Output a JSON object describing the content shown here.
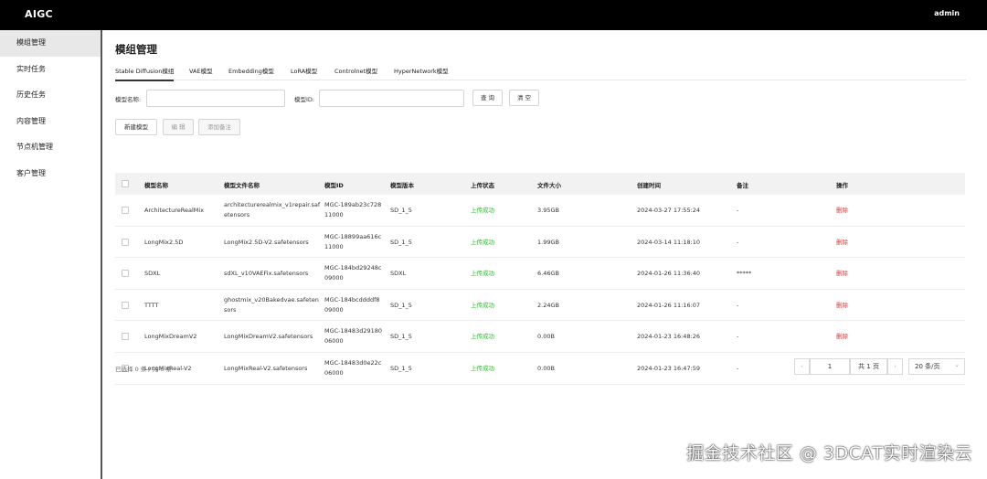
{
  "app": {
    "title": "AIGC",
    "user": "admin"
  },
  "sidebar": {
    "items": [
      {
        "label": "模组管理",
        "active": true
      },
      {
        "label": "实时任务",
        "active": false
      },
      {
        "label": "历史任务",
        "active": false
      },
      {
        "label": "内容管理",
        "active": false
      },
      {
        "label": "节点机管理",
        "active": false
      },
      {
        "label": "客户管理",
        "active": false
      }
    ]
  },
  "page": {
    "title": "模组管理"
  },
  "tabs": [
    {
      "label": "Stable Diffusion模组",
      "active": true
    },
    {
      "label": "VAE模型",
      "active": false
    },
    {
      "label": "Embedding模型",
      "active": false
    },
    {
      "label": "LoRA模型",
      "active": false
    },
    {
      "label": "Controlnet模型",
      "active": false
    },
    {
      "label": "HyperNetwork模型",
      "active": false
    }
  ],
  "search": {
    "name_label": "模型名称:",
    "name_value": "",
    "id_label": "模型ID:",
    "id_value": "",
    "query_button": "查 询",
    "clear_button": "清 空"
  },
  "actions": {
    "new_button": "新建模型",
    "edit_button": "编 辑",
    "note_button": "添加备注"
  },
  "table": {
    "headers": [
      "模型名称",
      "模型文件名称",
      "模型ID",
      "模型版本",
      "上传状态",
      "文件大小",
      "创建时间",
      "备注",
      "操作"
    ],
    "rows": [
      {
        "name": "ArchitectureRealMix",
        "file_l1": "architecturerealmix_v1repair.saf",
        "file_l2": "etensors",
        "id_l1": "MGC-189ab23c728",
        "id_l2": "11000",
        "version": "SD_1_5",
        "status": "上传成功",
        "size": "3.95GB",
        "created": "2024-03-27 17:55:24",
        "note": "-",
        "action": "删除"
      },
      {
        "name": "LongMix2.5D",
        "file_l1": "LongMix2.5D-V2.safetensors",
        "file_l2": "",
        "id_l1": "MGC-18899aa616c",
        "id_l2": "11000",
        "version": "SD_1_5",
        "status": "上传成功",
        "size": "1.99GB",
        "created": "2024-03-14 11:18:10",
        "note": "-",
        "action": "删除"
      },
      {
        "name": "SDXL",
        "file_l1": "sdXL_v10VAEFix.safetensors",
        "file_l2": "",
        "id_l1": "MGC-184bd29248c",
        "id_l2": "09000",
        "version": "SDXL",
        "status": "上传成功",
        "size": "6.46GB",
        "created": "2024-01-26 11:36:40",
        "note": "*****",
        "action": "删除"
      },
      {
        "name": "TTTT",
        "file_l1": "ghostmix_v20Bakedvae.safeten",
        "file_l2": "sors",
        "id_l1": "MGC-184bcddddf8",
        "id_l2": "09000",
        "version": "SD_1_5",
        "status": "上传成功",
        "size": "2.24GB",
        "created": "2024-01-26 11:16:07",
        "note": "-",
        "action": "删除"
      },
      {
        "name": "LongMixDreamV2",
        "file_l1": "LongMixDreamV2.safetensors",
        "file_l2": "",
        "id_l1": "MGC-18483d29180",
        "id_l2": "06000",
        "version": "SD_1_5",
        "status": "上传成功",
        "size": "0.00B",
        "created": "2024-01-23 16:48:26",
        "note": "-",
        "action": "删除"
      },
      {
        "name": "LongMixReal-V2",
        "file_l1": "LongMixReal-V2.safetensors",
        "file_l2": "",
        "id_l1": "MGC-18483d0e22c",
        "id_l2": "06000",
        "version": "SD_1_5",
        "status": "上传成功",
        "size": "0.00B",
        "created": "2024-01-23 16:47:59",
        "note": "-",
        "action": "删除"
      }
    ]
  },
  "footer": {
    "selection": "已选择 0 条 / 共 6 条"
  },
  "pagination": {
    "prev_icon": "‹",
    "page_value": "1",
    "total_pages": "共 1 页",
    "next_icon": "›",
    "page_size": "20 条/页",
    "page_size_icon": "⌄"
  },
  "watermark": "掘金技术社区 @ 3DCAT实时渲染云",
  "colors": {
    "topbar": "#000000",
    "status_success": "#2eb82e",
    "delete": "#e03a3a",
    "table_header_bg": "#f2f2f2"
  }
}
